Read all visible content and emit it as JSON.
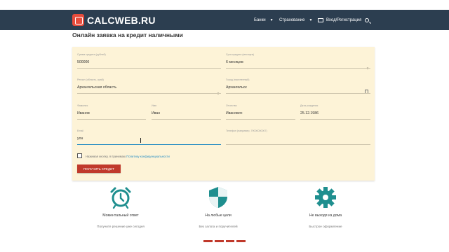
{
  "header": {
    "logo_text": "CALCWEB.RU",
    "nav": [
      {
        "label": "Банки"
      },
      {
        "label": "Страхование"
      },
      {
        "label": "Вход/Регистрация"
      }
    ]
  },
  "page_title": "Онлайн заявка на кредит наличными",
  "form": {
    "amount": {
      "label": "Сумма кредита (рублей)",
      "value": "500000"
    },
    "term": {
      "label": "Срок кредита (месяцев)",
      "value": "6 месяцев"
    },
    "region": {
      "label": "Регион (область, край)",
      "value": "Архангельская область"
    },
    "city": {
      "label": "Город (населенный)",
      "value": "Архангельск"
    },
    "lastname": {
      "label": "Фамилия",
      "value": "Иванов"
    },
    "firstname": {
      "label": "Имя",
      "value": "Иван"
    },
    "patronymic": {
      "label": "Отчество",
      "value": "Иванович"
    },
    "birthdate": {
      "label": "Дата рождения",
      "value": "25.12.1986"
    },
    "email": {
      "label": "Email",
      "value": "you"
    },
    "phone": {
      "label": "Телефон (например, 79000000007)",
      "value": ""
    },
    "consent_text": "Нажимая кнопку, я принимаю",
    "consent_link": "Политику конфиденциальности",
    "submit_label": "ПОЛУЧИТЬ КРЕДИТ"
  },
  "features": [
    {
      "title": "Моментальный ответ",
      "subtitle": "Получите решение уже сегодня"
    },
    {
      "title": "На любые цели",
      "subtitle": "Без залога и поручителей"
    },
    {
      "title": "Не выходя из дома",
      "subtitle": "Быстрое оформление"
    }
  ],
  "colors": {
    "nav_bg": "#2c3e50",
    "accent": "#c0392b",
    "card_bg": "#fdf3d7",
    "icon_teal": "#1f8f8f"
  }
}
